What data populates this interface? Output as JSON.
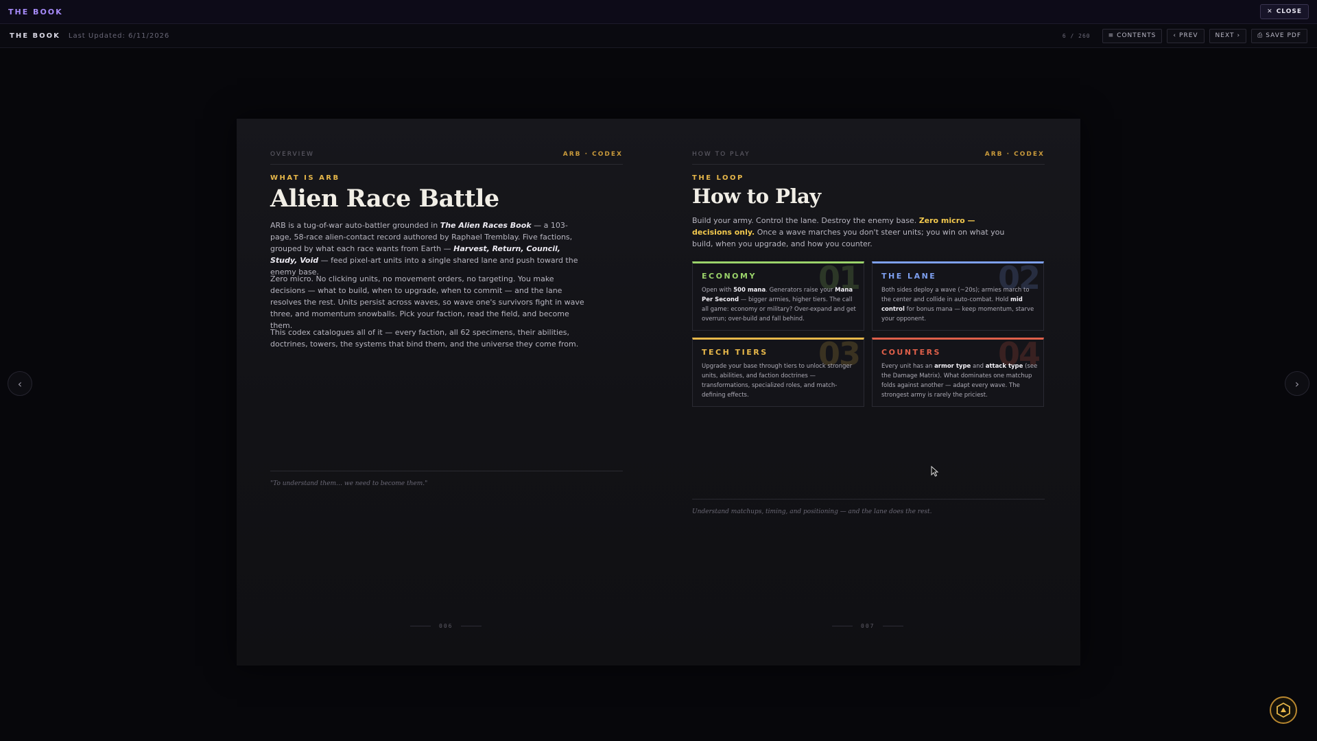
{
  "app": {
    "brand": "THE BOOK",
    "close_label": "CLOSE"
  },
  "toolbar": {
    "title": "THE BOOK",
    "updated": "Last Updated: 6/11/2026",
    "page_count": "6 / 260",
    "contents": "CONTENTS",
    "prev": "PREV",
    "next": "NEXT",
    "save_pdf": "SAVE PDF"
  },
  "left_page": {
    "section": "OVERVIEW",
    "codex": "ARB · CODEX",
    "kicker": "WHAT IS ARB",
    "title": "Alien Race Battle",
    "p1": [
      {
        "t": "ARB is a tug-of-war auto-battler grounded in "
      },
      {
        "t": "The Alien Races Book",
        "s": "bi"
      },
      {
        "t": " — a 103-page, 58-race alien-contact record authored by Raphael Tremblay. Five factions, grouped by what each race wants from Earth — "
      },
      {
        "t": "Harvest, Return, Council, Study, Void",
        "s": "bi"
      },
      {
        "t": " — feed pixel-art units into a single shared lane and push toward the enemy base."
      }
    ],
    "p2": "Zero micro. No clicking units, no movement orders, no targeting. You make decisions — what to build, when to upgrade, when to commit — and the lane resolves the rest. Units persist across waves, so wave one's survivors fight in wave three, and momentum snowballs. Pick your faction, read the field, and become them.",
    "p3": "This codex catalogues all of it — every faction, all 62 specimens, their abilities, doctrines, towers, the systems that bind them, and the universe they come from.",
    "quote": "\"To understand them… we need to become them.\"",
    "folio": "006"
  },
  "right_page": {
    "section": "HOW TO PLAY",
    "codex": "ARB · CODEX",
    "kicker": "THE LOOP",
    "title": "How to Play",
    "intro": [
      {
        "t": "Build your army. Control the lane. Destroy the enemy base. "
      },
      {
        "t": "Zero micro — decisions only.",
        "s": "hl"
      },
      {
        "t": " Once a wave marches you don't steer units; you win on what you build, when you upgrade, and how you counter."
      }
    ],
    "cards": [
      {
        "num": "01",
        "title": "ECONOMY",
        "color": "#9bd36a",
        "body": [
          {
            "t": "Open with "
          },
          {
            "t": "500 mana",
            "s": "b"
          },
          {
            "t": ". Generators raise your "
          },
          {
            "t": "Mana Per Second",
            "s": "b"
          },
          {
            "t": " — bigger armies, higher tiers. The call all game: economy or military? Over-expand and get overrun; over-build and fall behind."
          }
        ]
      },
      {
        "num": "02",
        "title": "THE LANE",
        "color": "#7ea0f0",
        "body": [
          {
            "t": "Both sides deploy a wave (~20s); armies march to the center and collide in auto-combat. Hold "
          },
          {
            "t": "mid control",
            "s": "b"
          },
          {
            "t": " for bonus mana — keep momentum, starve your opponent."
          }
        ]
      },
      {
        "num": "03",
        "title": "TECH TIERS",
        "color": "#e8b84a",
        "body": [
          {
            "t": "Upgrade your base through tiers to unlock stronger units, abilities, and faction doctrines — transformations, specialized roles, and match-defining effects."
          }
        ]
      },
      {
        "num": "04",
        "title": "COUNTERS",
        "color": "#e0604a",
        "body": [
          {
            "t": "Every unit has an "
          },
          {
            "t": "armor type",
            "s": "b"
          },
          {
            "t": " and "
          },
          {
            "t": "attack type",
            "s": "b"
          },
          {
            "t": " (see the Damage Matrix). What dominates one matchup folds against another — adapt every wave. The strongest army is rarely the priciest."
          }
        ]
      }
    ],
    "footer": "Understand matchups, timing, and positioning — and the lane does the rest.",
    "folio": "007"
  },
  "icons": {
    "close": "close-icon",
    "prev_page": "chevron-left-icon",
    "next_page": "chevron-right-icon",
    "badge": "hex-emblem-icon"
  },
  "colors": {
    "accent": "#e8b84a",
    "brand": "#a78bfa"
  }
}
